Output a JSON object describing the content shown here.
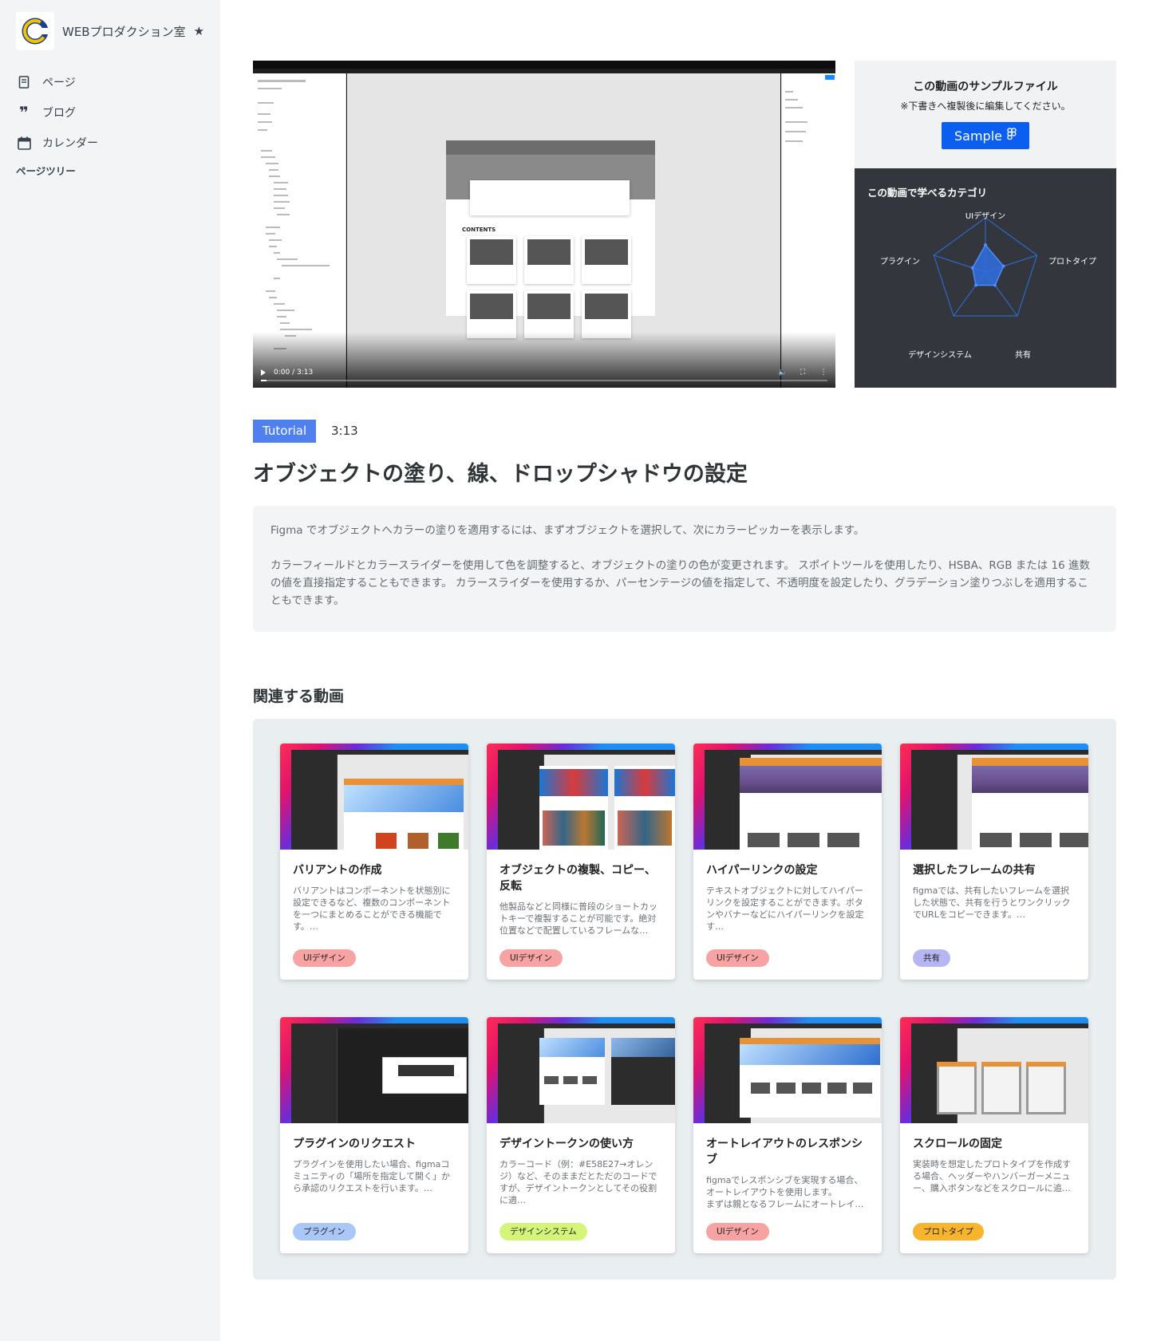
{
  "sidebar": {
    "site_name": "WEBプロダクション室",
    "favorite_icon": "star-icon",
    "nav": [
      {
        "label": "ページ",
        "icon": "document-icon"
      },
      {
        "label": "ブログ",
        "icon": "quote-icon"
      },
      {
        "label": "カレンダー",
        "icon": "calendar-icon"
      }
    ],
    "tree_title": "ページツリー"
  },
  "video": {
    "time": "0:00 / 3:13",
    "progress": 0.01
  },
  "sample": {
    "title": "この動画のサンプルファイル",
    "note": "※下書きへ複製後に編集してください。",
    "button": "Sample"
  },
  "radar": {
    "title": "この動画で学べるカテゴリ",
    "axes": [
      "UIデザイン",
      "プロトタイプ",
      "共有",
      "デザインシステム",
      "プラグイン"
    ],
    "values": [
      0.5,
      0.35,
      0.3,
      0.3,
      0.25
    ],
    "accent": "#2f6fe0"
  },
  "meta": {
    "badge": "Tutorial",
    "duration": "3:13",
    "title": "オブジェクトの塗り、線、ドロップシャドウの設定"
  },
  "description": {
    "p1": "Figma でオブジェクトへカラーの塗りを適用するには、まずオブジェクトを選択して、次にカラーピッカーを表示します。",
    "p2": "カラーフィールドとカラースライダーを使用して色を調整すると、オブジェクトの塗りの色が変更されます。 スポイトツールを使用したり、HSBA、RGB または 16 進数の値を直接指定することもできます。 カラースライダーを使用するか、パーセンテージの値を指定して、不透明度を設定したり、グラデーション塗りつぶしを適用することもできます。"
  },
  "related": {
    "title": "関連する動画",
    "cards": [
      {
        "title": "バリアントの作成",
        "text": "バリアントはコンポーネントを状態別に設定できるなど、複数のコンポーネントを一つにまとめることができる機能です。…",
        "tag": "UIデザイン",
        "tag_color": "#f7a3a3"
      },
      {
        "title": "オブジェクトの複製、コピー、反転",
        "text": "他製品などと同様に普段のショートカットキーで複製することが可能です。絶対位置などで配置しているフレームな…",
        "tag": "UIデザイン",
        "tag_color": "#f7a3a3"
      },
      {
        "title": "ハイパーリンクの設定",
        "text": "テキストオブジェクトに対してハイパーリンクを設定することができます。ボタンやバナーなどにハイパーリンクを設定す…",
        "tag": "UIデザイン",
        "tag_color": "#f7a3a3"
      },
      {
        "title": "選択したフレームの共有",
        "text": "figmaでは、共有したいフレームを選択した状態で、共有を行うとワンクリックでURLをコピーできます。…",
        "tag": "共有",
        "tag_color": "#b7b6f4"
      },
      {
        "title": "プラグインのリクエスト",
        "text": "プラグインを使用したい場合、figmaコミュニティの「場所を指定して開く」から承認のリクエストを行います。…",
        "tag": "プラグイン",
        "tag_color": "#aac8f7"
      },
      {
        "title": "デザイントークンの使い方",
        "text": "カラーコード（例：#E58E27→オレンジ）など、そのままだとただのコードですが、デザイントークンとしてその役割に適…",
        "tag": "デザインシステム",
        "tag_color": "#d4f57a"
      },
      {
        "title": "オートレイアウトのレスポンシブ",
        "text": "figmaでレスポンシブを実現する場合、オートレイアウトを使用します。\nまずは親となるフレームにオートレイ…",
        "tag": "UIデザイン",
        "tag_color": "#f7a3a3"
      },
      {
        "title": "スクロールの固定",
        "text": "実装時を想定したプロトタイプを作成する場合、ヘッダーやハンバーガーメニュー、購入ボタンなどをスクロールに追…",
        "tag": "プロトタイプ",
        "tag_color": "#f7b42c"
      }
    ]
  }
}
